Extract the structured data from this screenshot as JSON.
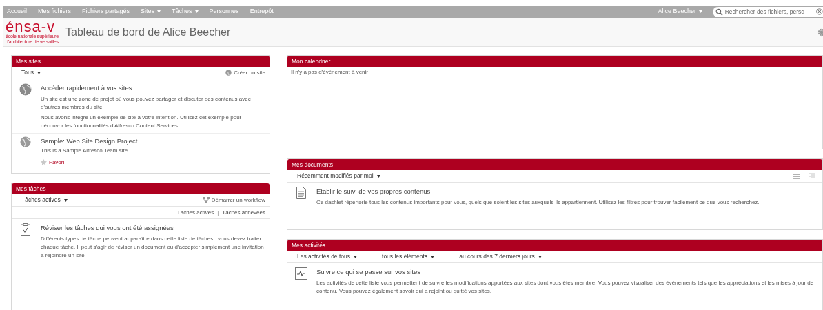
{
  "nav": {
    "items": [
      {
        "label": "Accueil",
        "dropdown": false
      },
      {
        "label": "Mes fichiers",
        "dropdown": false
      },
      {
        "label": "Fichiers partagés",
        "dropdown": false
      },
      {
        "label": "Sites",
        "dropdown": true
      },
      {
        "label": "Tâches",
        "dropdown": true
      },
      {
        "label": "Personnes",
        "dropdown": false
      },
      {
        "label": "Entrepôt",
        "dropdown": false
      }
    ],
    "user": {
      "label": "Alice Beecher"
    },
    "search": {
      "placeholder": "Rechercher des fichiers, persc"
    }
  },
  "header": {
    "logo": {
      "wordmark": "énsa-v",
      "subtitle_lines": [
        "école nationale supérieure",
        "d'architecture de versailles"
      ]
    },
    "title": "Tableau de bord de Alice Beecher"
  },
  "columns": [
    [
      {
        "kind": "sites",
        "title": "Mes sites",
        "filters": [
          "Tous"
        ],
        "action": "Créer un site",
        "intro": {
          "title": "Accéder rapidement à vos sites",
          "paragraphs": [
            "Un site est une zone de projet où vous pouvez partager et discuter des contenus avec d'autres membres du site.",
            "Nous avons intégré un exemple de site à votre intention. Utilisez cet exemple pour découvrir les fonctionnalités d'Alfresco Content Services."
          ]
        },
        "items": [
          {
            "name": "Sample: Web Site Design Project",
            "description": "This is a Sample Alfresco Team site.",
            "favorite_label": "Favori",
            "favorite": false
          }
        ]
      },
      {
        "kind": "tasks",
        "title": "Mes tâches",
        "filters": [
          "Tâches actives"
        ],
        "action": "Démarrer un workflow",
        "links": [
          "Tâches actives",
          "Tâches achevées"
        ],
        "link_separator": "|",
        "intro": {
          "title": "Réviser les tâches qui vous ont été assignées",
          "paragraphs": [
            "Différents types de tâche peuvent apparaître dans cette liste de tâches : vous devez traiter chaque tâche. Il peut s'agir de réviser un document ou d'accepter simplement une invitation à rejoindre un site."
          ]
        }
      }
    ],
    [
      {
        "kind": "calendar",
        "title": "Mon calendrier",
        "message": "Il n'y a pas d'événement à venir"
      },
      {
        "kind": "documents",
        "title": "Mes documents",
        "filters": [
          "Récemment modifiés par moi"
        ],
        "views": [
          {
            "selected": true
          },
          {
            "selected": false
          }
        ],
        "intro": {
          "title": "Etablir le suivi de vos propres contenus",
          "paragraphs": [
            "Ce dashlet répertorie tous les contenus importants pour vous, quels que soient les sites auxquels ils appartiennent. Utilisez les filtres pour trouver facilement ce que vous recherchez."
          ]
        }
      },
      {
        "kind": "activities",
        "title": "Mes activités",
        "filters": [
          "Les activités de tous",
          "tous les éléments",
          "au cours des 7 derniers jours"
        ],
        "intro": {
          "title": "Suivre ce qui se passe sur vos sites",
          "paragraphs": [
            "Les activités de cette liste vous permettent de suivre les modifications apportées aux sites dont vous êtes membre. Vous pouvez visualiser des événements tels que les appréciations et les mises à jour de contenu. Vous pouvez également savoir qui a rejoint ou quitté vos sites."
          ]
        }
      }
    ]
  ]
}
